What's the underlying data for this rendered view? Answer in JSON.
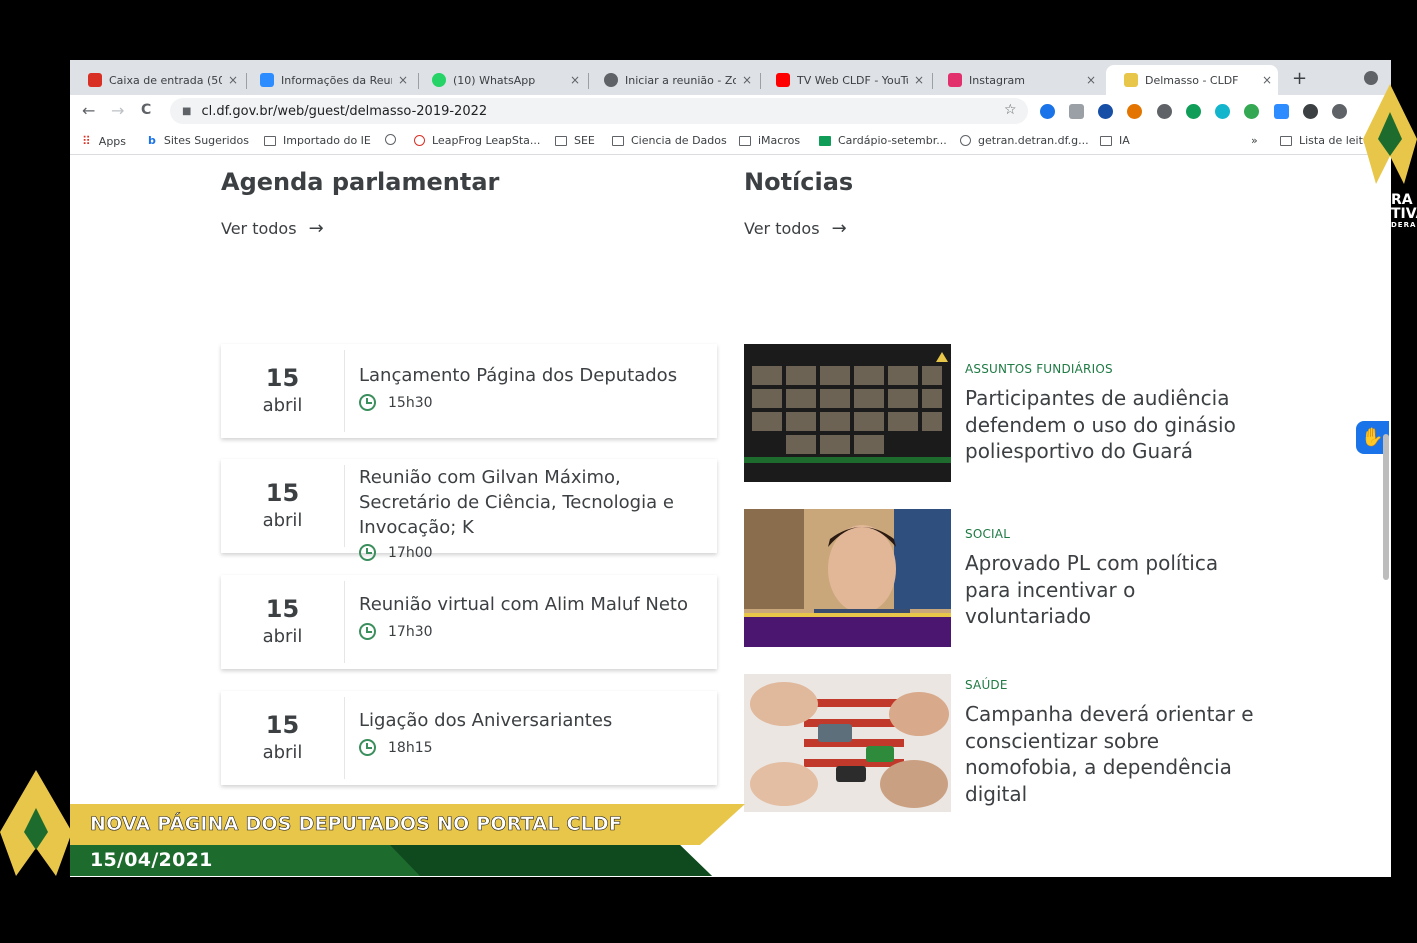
{
  "browser": {
    "tabs": [
      {
        "label": "Caixa de entrada (50",
        "active": false,
        "favicon_color": "#d93025"
      },
      {
        "label": "Informações da Reuni",
        "active": false,
        "favicon_color": "#2d8cff"
      },
      {
        "label": "(10) WhatsApp",
        "active": false,
        "favicon_color": "#25d366"
      },
      {
        "label": "Iniciar a reunião - Zo",
        "active": false,
        "favicon_color": "#5f6368"
      },
      {
        "label": "TV Web CLDF - YouTu",
        "active": false,
        "favicon_color": "#ff0000"
      },
      {
        "label": "Instagram",
        "active": false,
        "favicon_color": "#e1306c"
      },
      {
        "label": "Delmasso - CLDF",
        "active": true,
        "favicon_color": "#e8c64a"
      }
    ],
    "new_tab_symbol": "+",
    "close_symbol": "×",
    "back_symbol": "←",
    "forward_symbol": "→",
    "reload_symbol": "C",
    "address": "cl.df.gov.br/web/guest/delmasso-2019-2022",
    "star_symbol": "☆",
    "bookmarks": [
      {
        "label": "Apps"
      },
      {
        "label": "Sites Sugeridos"
      },
      {
        "label": "Importado do IE"
      },
      {
        "label": ""
      },
      {
        "label": "LeapFrog LeapSta..."
      },
      {
        "label": "SEE"
      },
      {
        "label": "Ciencia de Dados"
      },
      {
        "label": "iMacros"
      },
      {
        "label": "Cardápio-setembr..."
      },
      {
        "label": "getran.detran.df.g..."
      },
      {
        "label": "IA"
      }
    ],
    "more_bookmarks": "»",
    "reading_list": "Lista de leitura"
  },
  "agenda": {
    "title": "Agenda parlamentar",
    "see_all": "Ver todos",
    "events": [
      {
        "day": "15",
        "month": "abril",
        "title": "Lançamento Página dos Deputados",
        "time": "15h30"
      },
      {
        "day": "15",
        "month": "abril",
        "title": "Reunião com Gilvan Máximo, Secretário de Ciência, Tecnologia e Invocação; K",
        "time": "17h00"
      },
      {
        "day": "15",
        "month": "abril",
        "title": "Reunião virtual com Alim Maluf Neto",
        "time": "17h30"
      },
      {
        "day": "15",
        "month": "abril",
        "title": "Ligação dos Aniversariantes",
        "time": "18h15"
      }
    ]
  },
  "news": {
    "title": "Notícias",
    "see_all": "Ver todos",
    "items": [
      {
        "category": "ASSUNTOS FUNDIÁRIOS",
        "title": "Participantes de audiência defendem o uso do ginásio poliesportivo do Guará"
      },
      {
        "category": "SOCIAL",
        "title": "Aprovado PL com política para incentivar o voluntariado"
      },
      {
        "category": "SAÚDE",
        "title": "Campanha deverá orientar e conscientizar sobre nomofobia, a dependência digital"
      }
    ]
  },
  "broadcast": {
    "headline": "NOVA PÁGINA DOS DEPUTADOS NO PORTAL CLDF",
    "date": "15/04/2021",
    "logo_text_lines": [
      "RA",
      "TIVA",
      "DERA"
    ],
    "colors": {
      "gold": "#e8c64a",
      "green": "#1e6b2e",
      "dark_green": "#0f4a1f"
    }
  },
  "colors": {
    "accent_green": "#1f7a44",
    "link_blue": "#1a73e8"
  }
}
